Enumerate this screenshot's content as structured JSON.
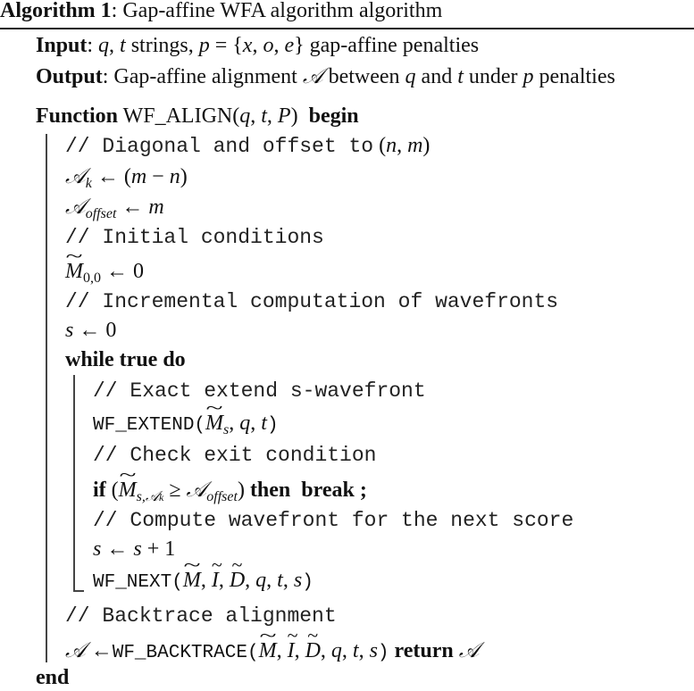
{
  "algorithm": {
    "label": "Algorithm 1",
    "title": "Gap-affine WFA algorithm algorithm",
    "input_label": "Input",
    "input_text": "q, t strings, p = {x, o, e} gap-affine penalties",
    "output_label": "Output",
    "output_text": "Gap-affine alignment 𝒜 between q and t under p penalties",
    "function_kw": "Function",
    "function_name": "WF_ALIGN",
    "function_args": "(q, t, P)",
    "begin_kw": "begin",
    "lines": [
      {
        "kind": "comment",
        "text": "// Diagonal and offset to",
        "math": "(n, m)"
      },
      {
        "kind": "assign",
        "lhs": "𝒜",
        "lhs_sub": "k",
        "op": "←",
        "rhs": "(m − n)"
      },
      {
        "kind": "assign",
        "lhs": "𝒜",
        "lhs_sub": "offset",
        "op": "←",
        "rhs": "m"
      },
      {
        "kind": "comment",
        "text": "// Initial conditions"
      },
      {
        "kind": "assign",
        "lhs": "M",
        "lhs_sub": "0,0",
        "op": "←",
        "rhs": "0"
      },
      {
        "kind": "comment",
        "text": "// Incremental computation of wavefronts"
      },
      {
        "kind": "assign",
        "lhs": "s",
        "op": "←",
        "rhs": "0"
      },
      {
        "kind": "loop",
        "kw_while": "while",
        "cond": "true",
        "kw_do": "do"
      },
      {
        "kind": "comment",
        "text": "// Exact extend s-wavefront"
      },
      {
        "kind": "call",
        "name": "WF_EXTEND",
        "args": "M_s, q, t"
      },
      {
        "kind": "comment",
        "text": "// Check exit condition"
      },
      {
        "kind": "if",
        "kw_if": "if",
        "cond": "(M_{s,𝒜k} ≥ 𝒜offset)",
        "kw_then": "then",
        "kw_break": "break",
        "terminator": ";"
      },
      {
        "kind": "comment",
        "text": "// Compute wavefront for the next score"
      },
      {
        "kind": "assign",
        "lhs": "s",
        "op": "←",
        "rhs": "s + 1"
      },
      {
        "kind": "call",
        "name": "WF_NEXT",
        "args": "M, I, D, q, t, s"
      },
      {
        "kind": "comment",
        "text": "// Backtrace alignment"
      },
      {
        "kind": "call",
        "name": "WF_BACKTRACE",
        "lhs": "𝒜",
        "op": "←",
        "args": "M, I, D, q, t, s",
        "kw_return": "return",
        "return_value": "𝒜"
      }
    ],
    "end_kw": "end"
  }
}
